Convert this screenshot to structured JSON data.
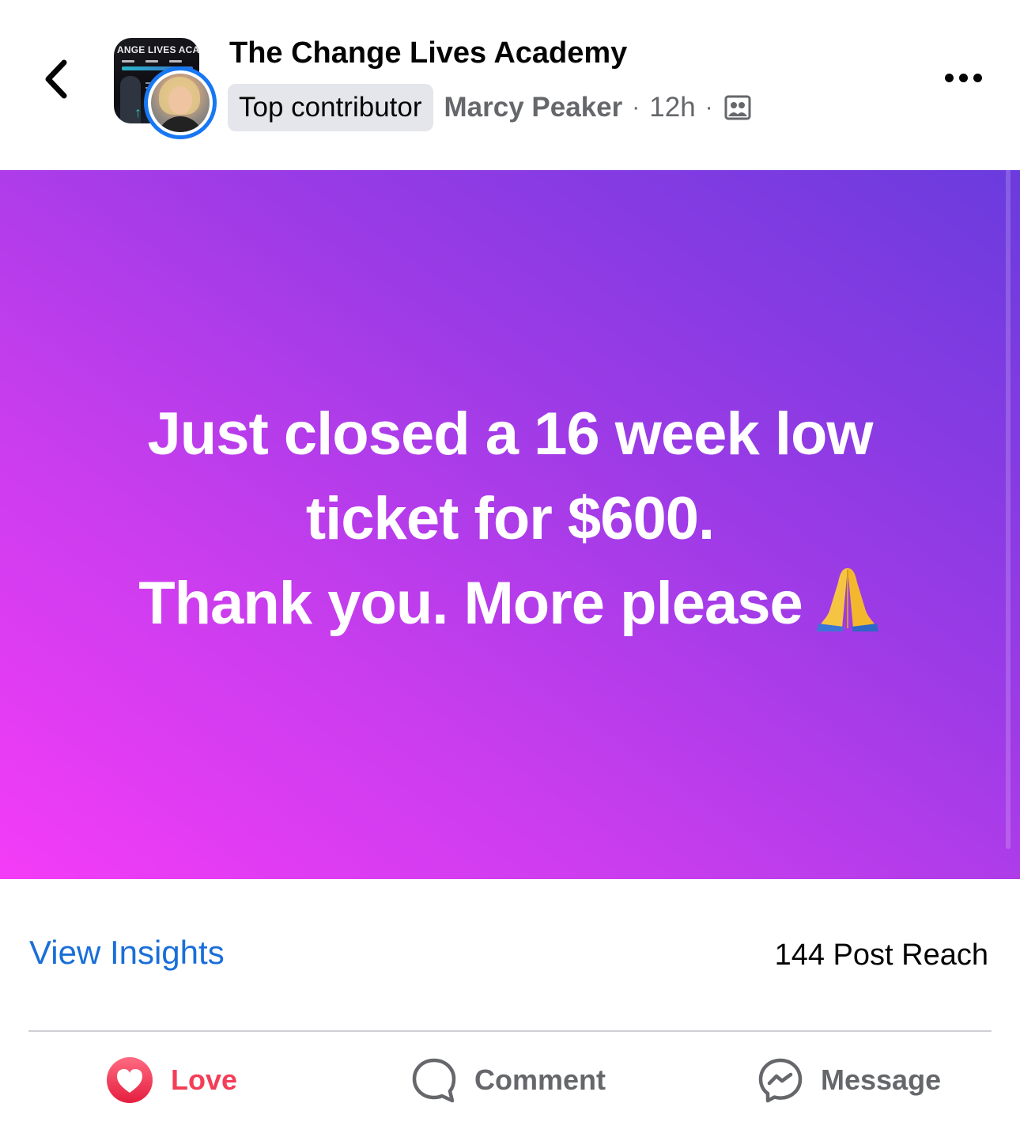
{
  "header": {
    "group_name": "The Change Lives Academy",
    "group_avatar_text": "ANGE LIVES ACAD",
    "badge": "Top contributor",
    "author": "Marcy Peaker",
    "separator": "·",
    "time": "12h",
    "audience_icon": "group-members-icon",
    "back_icon": "chevron-left-icon",
    "more_icon": "more-horizontal-icon"
  },
  "post": {
    "lines": [
      "Just closed a 16 week low",
      "ticket for $600.",
      "Thank you. More please"
    ],
    "emoji": "folded-hands-emoji",
    "background_colors": [
      "#f43cf7",
      "#c53ded",
      "#9b3be6",
      "#6a3bdd"
    ]
  },
  "insights": {
    "link_label": "View Insights",
    "reach_text": "144 Post Reach"
  },
  "actions": {
    "love": {
      "label": "Love",
      "icon": "love-reaction-icon",
      "color": "#f33e58"
    },
    "comment": {
      "label": "Comment",
      "icon": "comment-icon"
    },
    "message": {
      "label": "Message",
      "icon": "messenger-icon"
    }
  },
  "colors": {
    "accent_blue": "#1877f2",
    "link_blue": "#1a6ed8",
    "secondary_text": "#65676b",
    "badge_bg": "#e4e6eb"
  }
}
